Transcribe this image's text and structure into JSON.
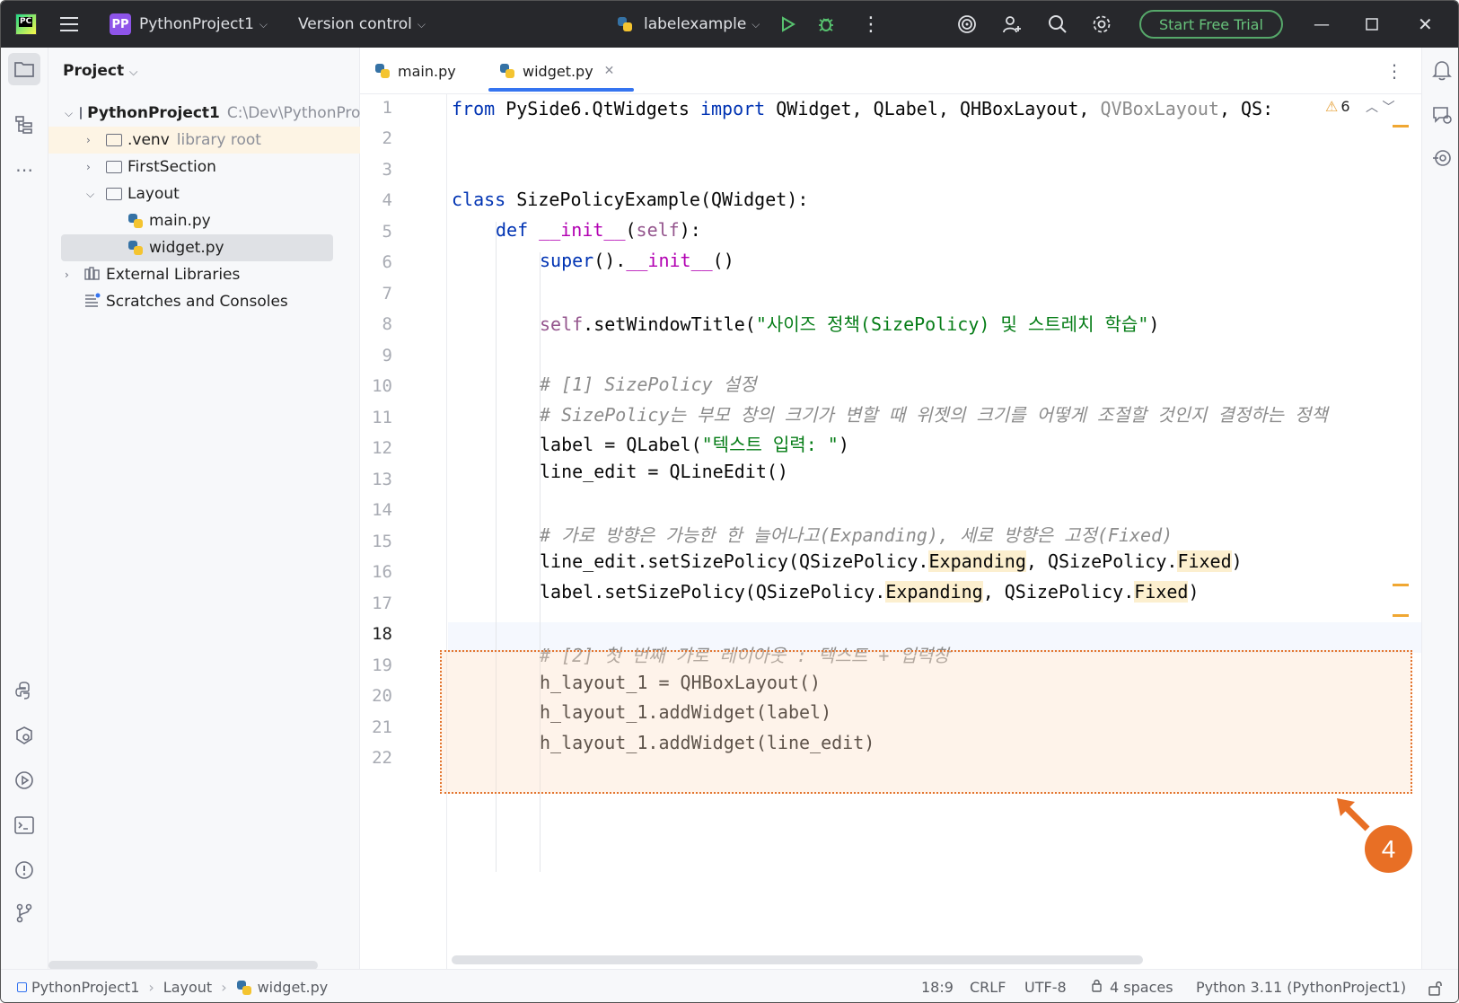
{
  "titlebar": {
    "logo_text": "PC",
    "project_badge": "PP",
    "project_name": "PythonProject1",
    "version_control": "Version control",
    "run_config": "labelexample",
    "trial_button": "Start Free Trial"
  },
  "project_panel": {
    "title": "Project",
    "tree": [
      {
        "label": "PythonProject1",
        "extra": "C:\\Dev\\PythonProj",
        "level": 0,
        "type": "folder",
        "expanded": true
      },
      {
        "label": ".venv",
        "extra": "library root",
        "level": 1,
        "type": "folder",
        "expanded": false
      },
      {
        "label": "FirstSection",
        "extra": "",
        "level": 1,
        "type": "folder",
        "expanded": false
      },
      {
        "label": "Layout",
        "extra": "",
        "level": 1,
        "type": "folder",
        "expanded": true
      },
      {
        "label": "main.py",
        "extra": "",
        "level": 2,
        "type": "python"
      },
      {
        "label": "widget.py",
        "extra": "",
        "level": 2,
        "type": "python",
        "selected": true
      },
      {
        "label": "External Libraries",
        "extra": "",
        "level": 0,
        "type": "library"
      },
      {
        "label": "Scratches and Consoles",
        "extra": "",
        "level": 0,
        "type": "scratch"
      }
    ]
  },
  "editor": {
    "tabs": [
      {
        "label": "main.py",
        "active": false
      },
      {
        "label": "widget.py",
        "active": true
      }
    ],
    "warning_count": "6",
    "line_numbers": [
      "1",
      "2",
      "3",
      "4",
      "5",
      "6",
      "7",
      "8",
      "9",
      "10",
      "11",
      "12",
      "13",
      "14",
      "15",
      "16",
      "17",
      "18",
      "19",
      "20",
      "21",
      "22"
    ],
    "code": {
      "l1_from": "from",
      "l1_mod": " PySide6.QtWidgets ",
      "l1_import": "import",
      "l1_names": " QWidget, QLabel, QHBoxLayout, ",
      "l1_unused": "QVBoxLayout",
      "l1_rest": ", QS:",
      "l4_class": "class",
      "l4_rest": " SizePolicyExample(QWidget):",
      "l5_def": "def",
      "l5_init": "__init__",
      "l5_self": "self",
      "l6_super": "super",
      "l6_init": "__init__",
      "l8_self": "self",
      "l8_call": ".setWindowTitle(",
      "l8_str": "\"사이즈 정책(SizePolicy) 및 스트레치 학습\"",
      "l10": "# [1] SizePolicy 설정",
      "l11": "# SizePolicy는 부모 창의 크기가 변할 때 위젯의 크기를 어떻게 조절할 것인지 결정하는 정책",
      "l12_a": "label = QLabel(",
      "l12_str": "\"텍스트 입력: \"",
      "l13": "line_edit = QLineEdit()",
      "l15": "# 가로 방향은 가능한 한 늘어나고(Expanding), 세로 방향은 고정(Fixed)",
      "l16_a": "line_edit.setSizePolicy(QSizePolicy.",
      "l16_exp": "Expanding",
      "l16_b": ", QSizePolicy.",
      "l16_fix": "Fixed",
      "l17_a": "label.setSizePolicy(QSizePolicy.",
      "l17_exp": "Expanding",
      "l17_b": ", QSizePolicy.",
      "l17_fix": "Fixed",
      "l19": "# [2] 첫 번째 가로 레이아웃 : 텍스트 + 입력창",
      "l20": "h_layout_1 = QHBoxLayout()",
      "l21": "h_layout_1.addWidget(label)",
      "l22": "h_layout_1.addWidget(line_edit)"
    }
  },
  "annotation": {
    "badge": "4",
    "color": "#e86f25"
  },
  "statusbar": {
    "breadcrumb": [
      "PythonProject1",
      "Layout",
      "widget.py"
    ],
    "position": "18:9",
    "line_ending": "CRLF",
    "encoding": "UTF-8",
    "indent": "4 spaces",
    "interpreter": "Python 3.11 (PythonProject1)"
  },
  "colors": {
    "titlebar_bg": "#27282c",
    "accent": "#3574f0",
    "trial_green": "#56a86a",
    "highlight_border": "#e3752f"
  }
}
